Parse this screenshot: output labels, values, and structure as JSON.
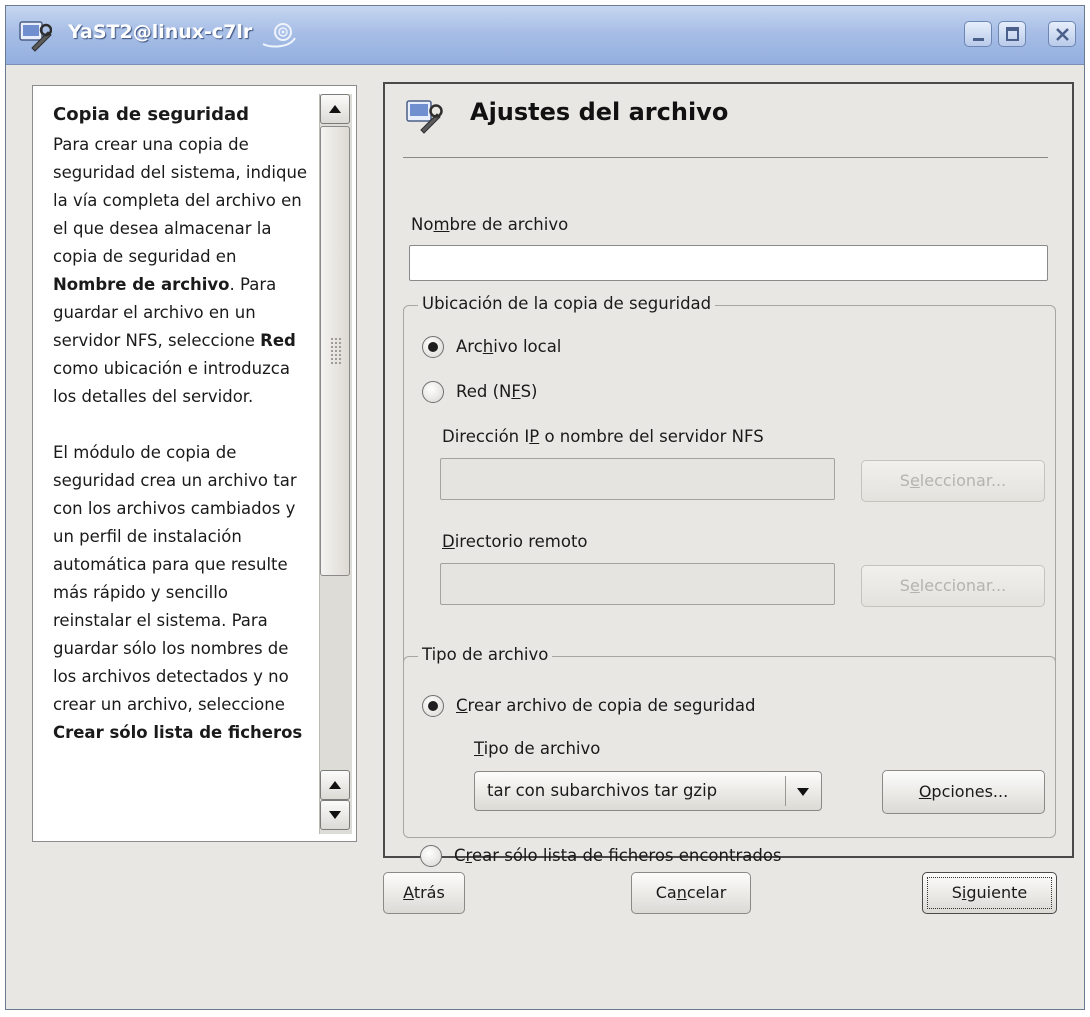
{
  "window": {
    "title": "YaST2@linux-c7lr"
  },
  "help": {
    "title": "Copia de seguridad",
    "p1": {
      "t1": "Para crear una copia de seguridad del sistema, indique la vía completa del archivo en el que desea almacenar la copia de seguridad en ",
      "b1": "Nombre de archivo",
      "t2": ". Para guardar el archivo en un servidor NFS, seleccione ",
      "b2": "Red",
      "t3": " como ubicación e introduzca los detalles del servidor."
    },
    "p2": {
      "t1": "El módulo de copia de seguridad crea un archivo tar con los archivos cambiados y un perfil de instalación automática para que resulte más rápido y sencillo reinstalar el sistema. Para guardar sólo los nombres de los archivos detectados y no crear un archivo, seleccione ",
      "b1": "Crear sólo lista de ficheros"
    }
  },
  "main": {
    "heading": "Ajustes del archivo",
    "filename": {
      "label_pre": "No",
      "label_ul": "m",
      "label_post": "bre de archivo",
      "value": ""
    },
    "location_group": {
      "title": "Ubicación de la copia de seguridad",
      "local": {
        "pre": "Arc",
        "ul": "h",
        "post": "ivo local",
        "selected": true
      },
      "network": {
        "pre": "Red (N",
        "ul": "F",
        "post": "S)",
        "selected": false
      },
      "ip_label": {
        "pre": "Dirección I",
        "ul": "P",
        "post": " o nombre del servidor NFS"
      },
      "ip_value": "",
      "select_button_1": {
        "pre": "S",
        "ul": "e",
        "post": "leccionar..."
      },
      "remote_dir_label": {
        "pre": "",
        "ul": "D",
        "post": "irectorio remoto"
      },
      "remote_dir_value": "",
      "select_button_2": {
        "pre": "S",
        "ul": "e",
        "post": "leccionar..."
      }
    },
    "archive_group": {
      "title": "Tipo de archivo",
      "create_archive": {
        "pre": "",
        "ul": "C",
        "post": "rear archivo de copia de seguridad",
        "selected": true
      },
      "type_label": {
        "pre": "",
        "ul": "T",
        "post": "ipo de archivo"
      },
      "type_selected": "tar con subarchivos tar gzip",
      "options_button": {
        "pre": "",
        "ul": "O",
        "post": "pciones..."
      },
      "list_only": {
        "pre": "C",
        "ul": "r",
        "post": "ear sólo lista de ficheros encontrados",
        "selected": false
      }
    }
  },
  "footer": {
    "back": {
      "pre": "",
      "ul": "A",
      "post": "trás"
    },
    "cancel": {
      "pre": "Ca",
      "ul": "n",
      "post": "celar"
    },
    "next": {
      "pre": "S",
      "ul": "i",
      "post": "guiente"
    }
  },
  "colors": {
    "titlebar": "#a7bee6",
    "window_bg": "#e9e7e3",
    "help_bg": "#ffffff"
  }
}
